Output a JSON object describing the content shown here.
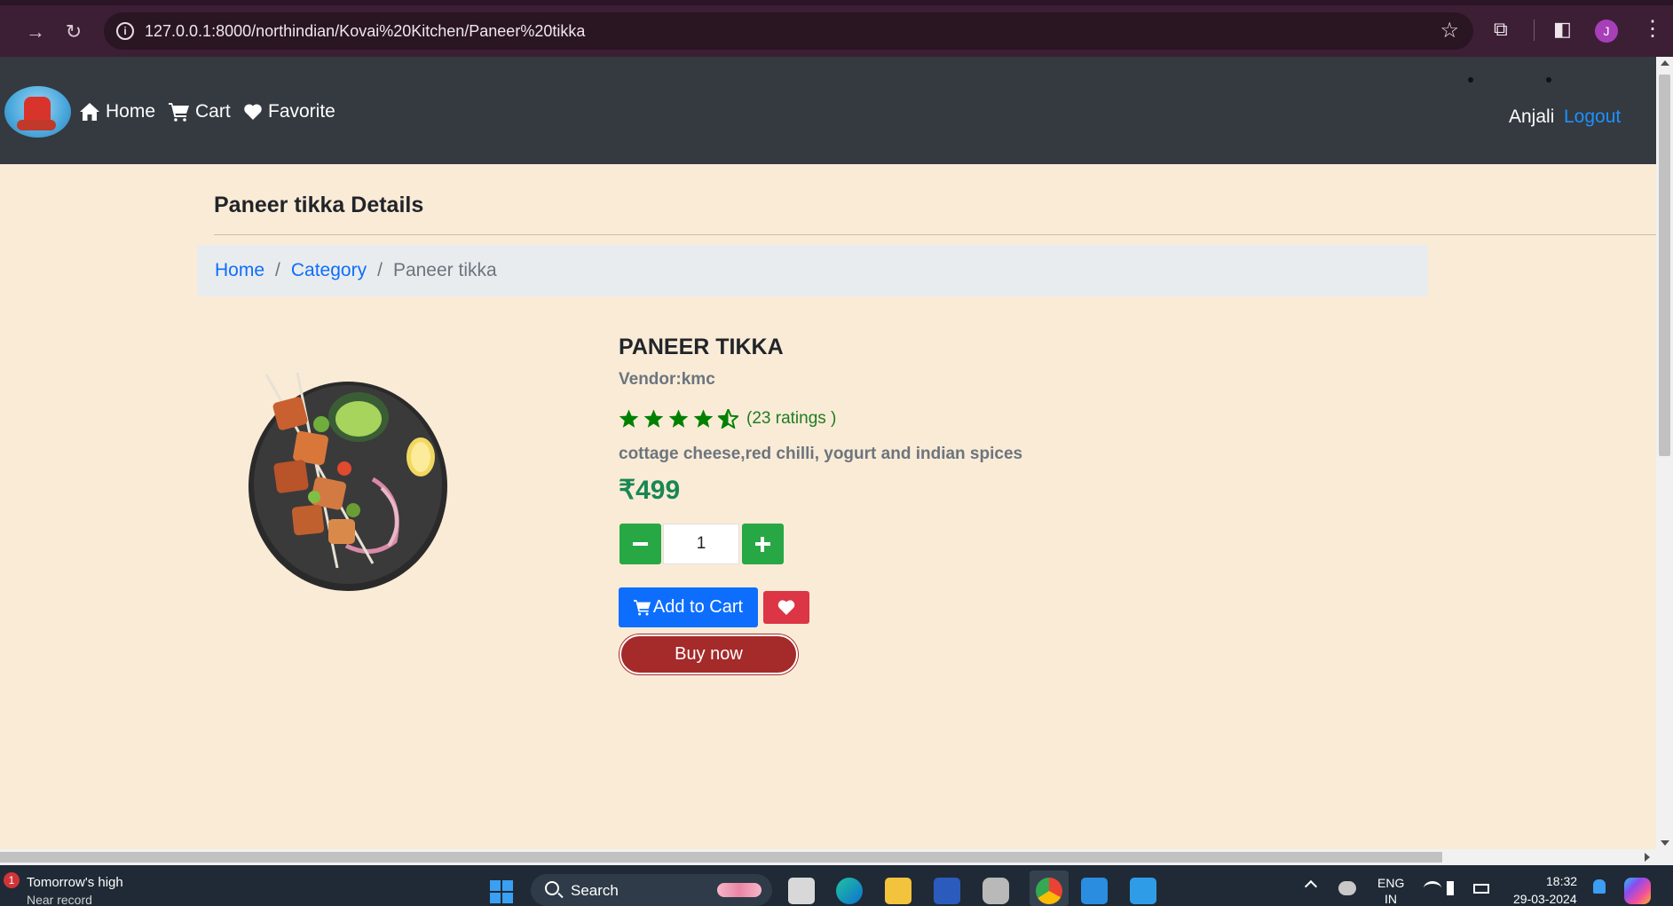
{
  "browser": {
    "url": "127.0.0.1:8000/northindian/Kovai%20Kitchen/Paneer%20tikka",
    "profile_initial": "J"
  },
  "navbar": {
    "links": [
      {
        "label": "Home",
        "icon": "home-icon"
      },
      {
        "label": "Cart",
        "icon": "cart-icon"
      },
      {
        "label": "Favorite",
        "icon": "heart-icon"
      }
    ],
    "user_name": "Anjali",
    "logout_label": "Logout"
  },
  "page": {
    "title": "Paneer tikka Details",
    "breadcrumb": [
      {
        "label": "Home",
        "link": true
      },
      {
        "label": "Category",
        "link": true
      },
      {
        "label": "Paneer tikka",
        "link": false
      }
    ]
  },
  "product": {
    "name": "PANEER TIKKA",
    "vendor": "Vendor:kmc",
    "rating_stars": 4.5,
    "rating_count": "(23 ratings )",
    "description": "cottage cheese,red chilli, yogurt and indian spices",
    "price": "₹499",
    "quantity": "1",
    "add_to_cart_label": "Add to Cart",
    "buy_now_label": "Buy now"
  },
  "colors": {
    "navbar_bg": "#343a40",
    "page_bg": "#faebd7",
    "accent_blue": "#0d6efd",
    "qty_green": "#28a745",
    "star_green": "#008000",
    "buy_now": "#a52a2a",
    "favorite_red": "#dc3545"
  },
  "taskbar": {
    "weather_badge": "1",
    "weather_title": "Tomorrow's high",
    "weather_subtitle": "Near record",
    "search_label": "Search",
    "language": "ENG",
    "region": "IN",
    "time": "18:32",
    "date": "29-03-2024"
  }
}
